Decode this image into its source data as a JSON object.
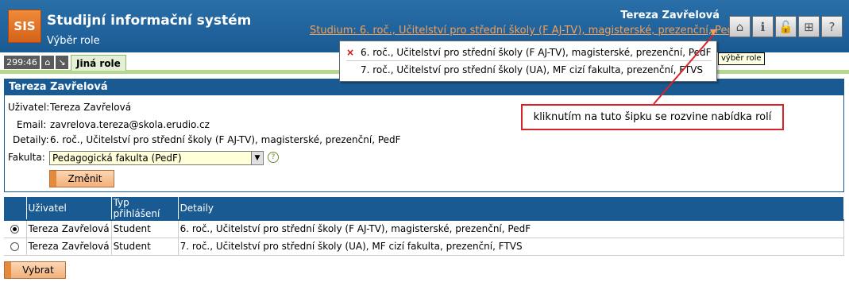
{
  "header": {
    "logo": "SIS",
    "title": "Studijní informační systém",
    "subtitle": "Výběr role",
    "user_name": "Tereza Zavřelová",
    "study_link": "Studium: 6. roč., Učitelství pro střední školy (F AJ-TV), magisterské, prezenční, PedF",
    "icons": [
      "home-icon",
      "info-icon",
      "lock-icon",
      "english-flag-icon",
      "help-icon"
    ]
  },
  "toolbar": {
    "timer": "299:46",
    "active_tab": "Jiná role"
  },
  "dropdown": {
    "items": [
      "6. roč., Učitelství pro střední školy (F AJ-TV), magisterské, prezenční, PedF",
      "7. roč., Učitelství pro střední školy (UA), MF cizí fakulta, prezenční, FTVS"
    ],
    "selected_marker": "×",
    "tooltip": "výběr role"
  },
  "panel": {
    "title": "Tereza Zavřelová",
    "user_label": "Uživatel:",
    "user_value": "Tereza Zavřelová",
    "email_label": "Email:",
    "email_value": "zavrelova.tereza@skola.erudio.cz",
    "details_label": "Detaily:",
    "details_value": "6. roč., Učitelství pro střední školy (F AJ-TV), magisterské, prezenční, PedF",
    "faculty_label": "Fakulta:",
    "faculty_value": "Pedagogická fakulta (PedF)",
    "change_button": "Změnit"
  },
  "callout": "kliknutím na tuto šipku se rozvine nabídka rolí",
  "table": {
    "headers": [
      "Uživatel",
      "Typ přihlášení",
      "Detaily"
    ],
    "rows": [
      {
        "user": "Tereza Zavřelová",
        "type": "Student",
        "details": "6. roč., Učitelství pro střední školy (F AJ-TV), magisterské, prezenční, PedF",
        "selected": true
      },
      {
        "user": "Tereza Zavřelová",
        "type": "Student",
        "details": "7. roč., Učitelství pro střední školy (UA), MF cizí fakulta, prezenční, FTVS",
        "selected": false
      }
    ]
  },
  "select_button": "Vybrat"
}
